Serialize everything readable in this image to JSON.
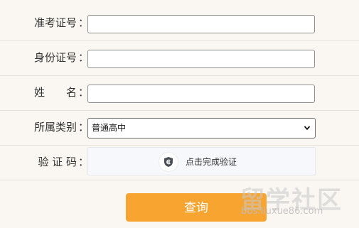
{
  "form": {
    "exam_number": {
      "label": "准考证号",
      "value": ""
    },
    "id_number": {
      "label": "身份证号",
      "value": ""
    },
    "name": {
      "label": "姓　　名",
      "value": ""
    },
    "category": {
      "label": "所属类别",
      "selected": "普通高中"
    },
    "captcha": {
      "label": "验 证 码",
      "prompt": "点击完成验证"
    },
    "colon": "：",
    "submit_label": "查询"
  },
  "watermark": {
    "title": "留学社区",
    "url": "bbs.liuxue86.com"
  },
  "colors": {
    "background": "#faf7f3",
    "accent": "#f7a431",
    "divider": "#e6e1db"
  }
}
